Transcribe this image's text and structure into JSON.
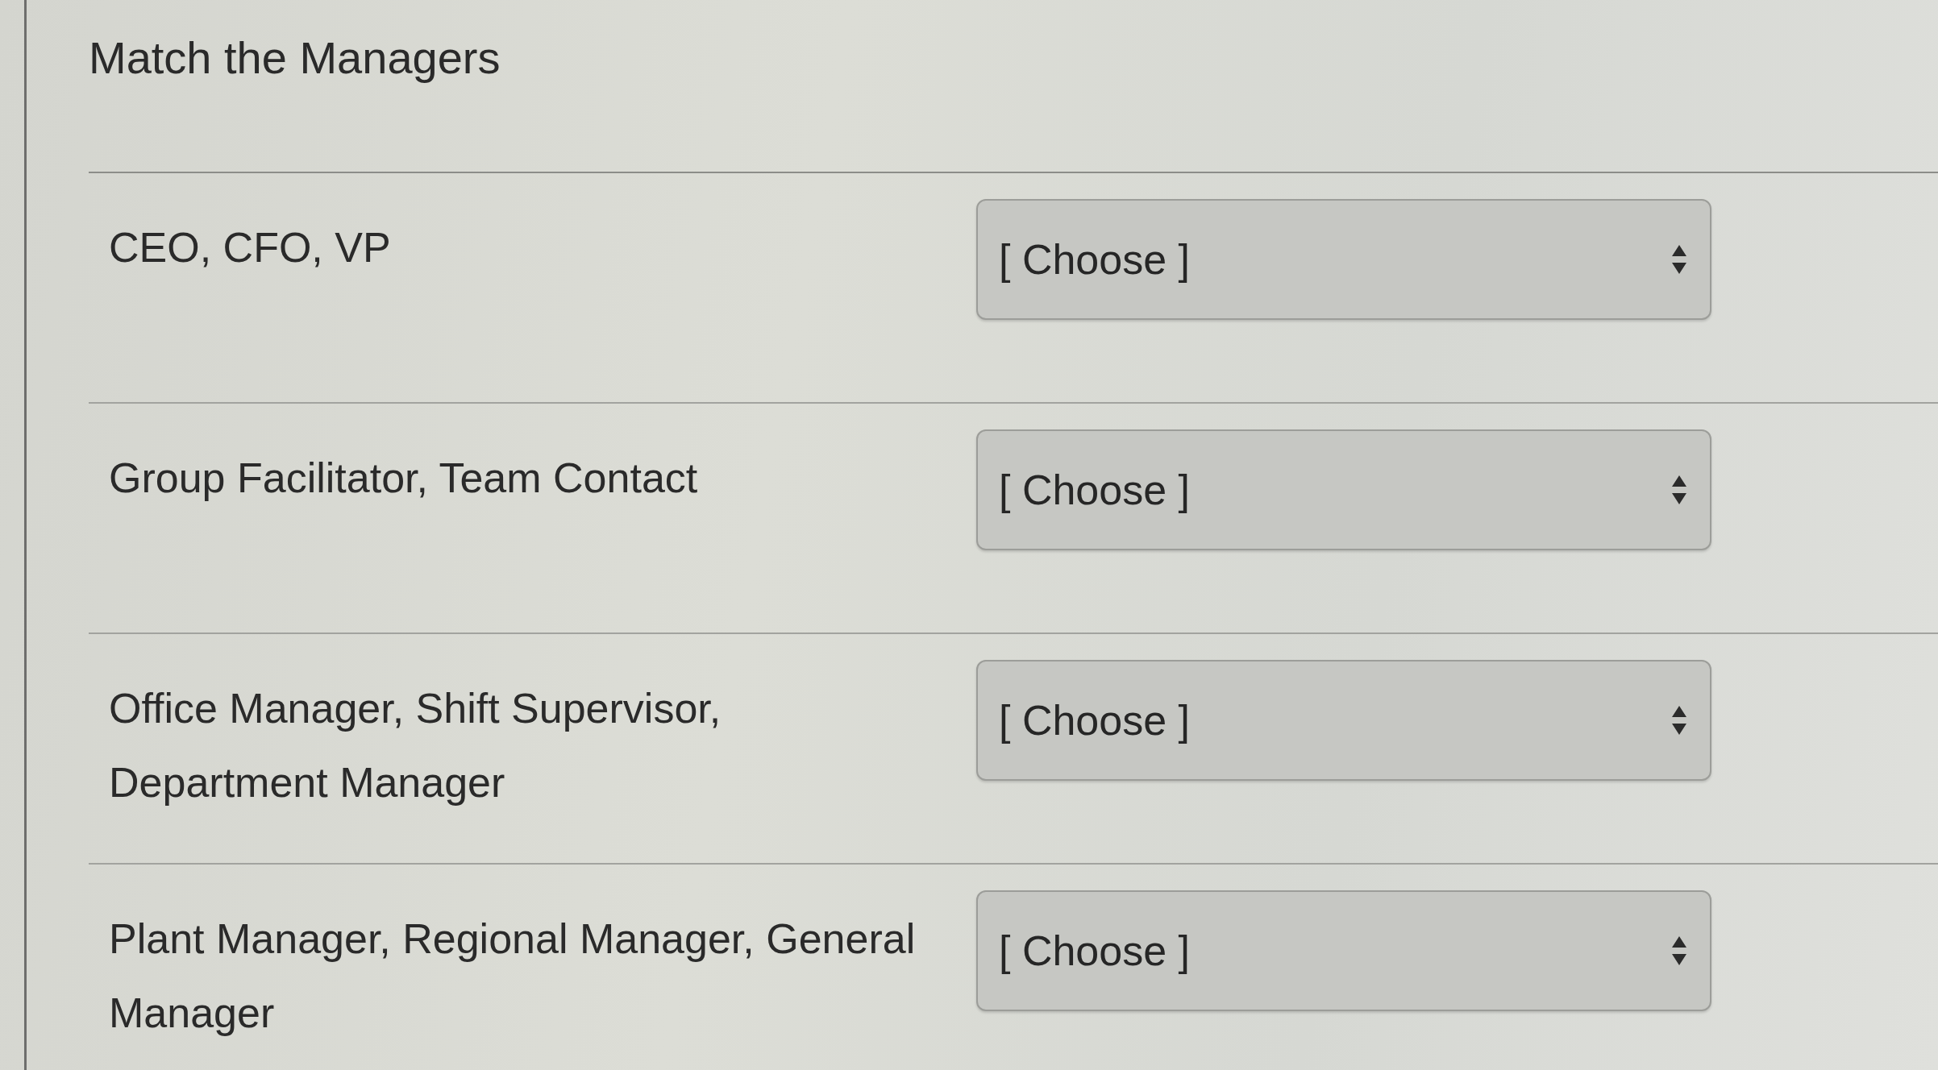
{
  "title": "Match the Managers",
  "questions": [
    {
      "prompt": "CEO, CFO, VP",
      "answer": "[ Choose ]"
    },
    {
      "prompt": "Group Facilitator, Team Contact",
      "answer": "[ Choose ]"
    },
    {
      "prompt": "Office Manager, Shift Supervisor, Department Manager",
      "answer": "[ Choose ]"
    },
    {
      "prompt": "Plant Manager, Regional Manager, General Manager",
      "answer": "[ Choose ]"
    }
  ]
}
